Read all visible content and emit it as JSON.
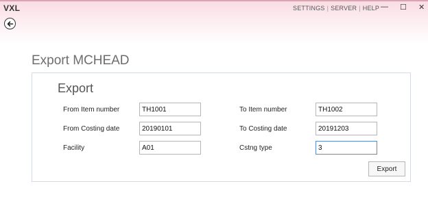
{
  "app": {
    "title": "VXL"
  },
  "topnav": {
    "settings": "SETTINGS",
    "server": "SERVER",
    "help": "HELP",
    "separator": "|"
  },
  "window_controls": {
    "minimize": "—",
    "maximize": "☐",
    "close": "✕"
  },
  "page": {
    "title": "Export MCHEAD",
    "section_title": "Export"
  },
  "form": {
    "from_item": {
      "label": "From Item number",
      "value": "TH1001"
    },
    "to_item": {
      "label": "To Item number",
      "value": "TH1002"
    },
    "from_date": {
      "label": "From Costing date",
      "value": "20190101"
    },
    "to_date": {
      "label": "To Costing date",
      "value": "20191203"
    },
    "facility": {
      "label": "Facility",
      "value": "A01"
    },
    "cstng_type": {
      "label": "Cstng type",
      "value": "3"
    }
  },
  "actions": {
    "export_label": "Export"
  },
  "icons": {
    "back": "back-arrow-icon"
  }
}
